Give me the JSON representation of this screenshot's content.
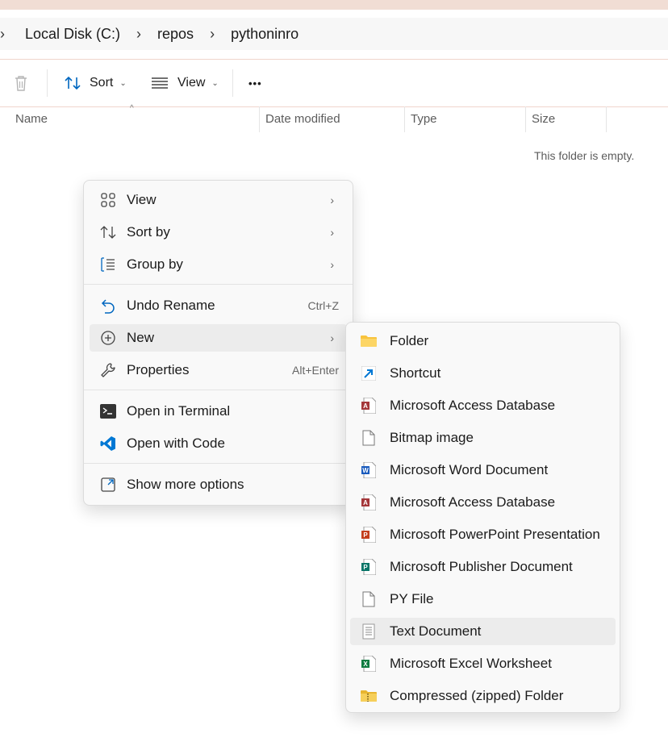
{
  "breadcrumb": {
    "items": [
      "Local Disk (C:)",
      "repos",
      "pythoninro"
    ],
    "separator": "›"
  },
  "toolbar": {
    "sort_label": "Sort",
    "view_label": "View",
    "more_label": "•••",
    "chevron": "⌄"
  },
  "columns": {
    "name": "Name",
    "date_modified": "Date modified",
    "type": "Type",
    "size": "Size",
    "sort_indicator": "^"
  },
  "empty_message": "This folder is empty.",
  "context_menu": {
    "view": {
      "label": "View",
      "icon": "grid-icon"
    },
    "sort_by": {
      "label": "Sort by",
      "icon": "sort-icon"
    },
    "group_by": {
      "label": "Group by",
      "icon": "group-icon"
    },
    "undo_rename": {
      "label": "Undo Rename",
      "shortcut": "Ctrl+Z",
      "icon": "undo-icon"
    },
    "new": {
      "label": "New",
      "icon": "plus-circle-icon"
    },
    "properties": {
      "label": "Properties",
      "shortcut": "Alt+Enter",
      "icon": "wrench-icon"
    },
    "open_terminal": {
      "label": "Open in Terminal",
      "icon": "terminal-icon"
    },
    "open_code": {
      "label": "Open with Code",
      "icon": "vscode-icon"
    },
    "show_more": {
      "label": "Show more options",
      "icon": "expand-icon"
    },
    "arrow": "›"
  },
  "new_submenu": [
    {
      "label": "Folder",
      "icon": "folder-icon"
    },
    {
      "label": "Shortcut",
      "icon": "shortcut-icon"
    },
    {
      "label": "Microsoft Access Database",
      "icon": "access-icon"
    },
    {
      "label": "Bitmap image",
      "icon": "file-icon"
    },
    {
      "label": "Microsoft Word Document",
      "icon": "word-icon"
    },
    {
      "label": "Microsoft Access Database",
      "icon": "access-icon"
    },
    {
      "label": "Microsoft PowerPoint Presentation",
      "icon": "powerpoint-icon"
    },
    {
      "label": "Microsoft Publisher Document",
      "icon": "publisher-icon"
    },
    {
      "label": "PY File",
      "icon": "file-icon"
    },
    {
      "label": "Text Document",
      "icon": "text-file-icon"
    },
    {
      "label": "Microsoft Excel Worksheet",
      "icon": "excel-icon"
    },
    {
      "label": "Compressed (zipped) Folder",
      "icon": "zip-folder-icon"
    }
  ],
  "colors": {
    "accent": "#0067c0",
    "menu_bg": "#f9f9f9",
    "hover": "#ececec",
    "title_strip": "#f1ddd4",
    "access": "#a4373a",
    "word": "#185abd",
    "powerpoint": "#c43e1c",
    "publisher": "#077568",
    "excel": "#107c41",
    "folder": "#f8c33c",
    "vscode": "#0078d4"
  }
}
